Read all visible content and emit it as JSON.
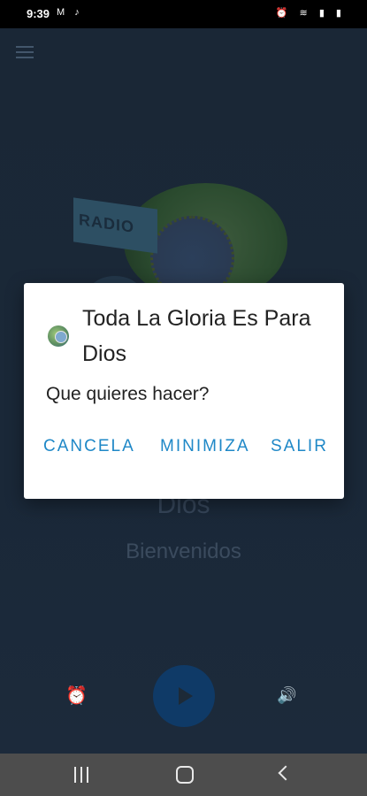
{
  "status_bar": {
    "time": "9:39",
    "left_icons": "M ♪",
    "right_icons": "⏰ ≋ ▮ ▮"
  },
  "app": {
    "logo_text": "RADIO",
    "station_title": "Dios",
    "station_subtitle": "Bienvenidos"
  },
  "controls": {
    "alarm_icon": "⏰",
    "volume_icon": "🔊"
  },
  "dialog": {
    "title": "Toda La Gloria Es Para Dios",
    "message": "Que quieres hacer?",
    "buttons": {
      "cancel": "CANCELA",
      "minimize": "MINIMIZA",
      "exit": "SALIR"
    }
  },
  "colors": {
    "accent": "#1f88c7",
    "app_background": "#1a2736",
    "play_button": "#0f3a67",
    "nav_bar": "#4d4d4d"
  }
}
